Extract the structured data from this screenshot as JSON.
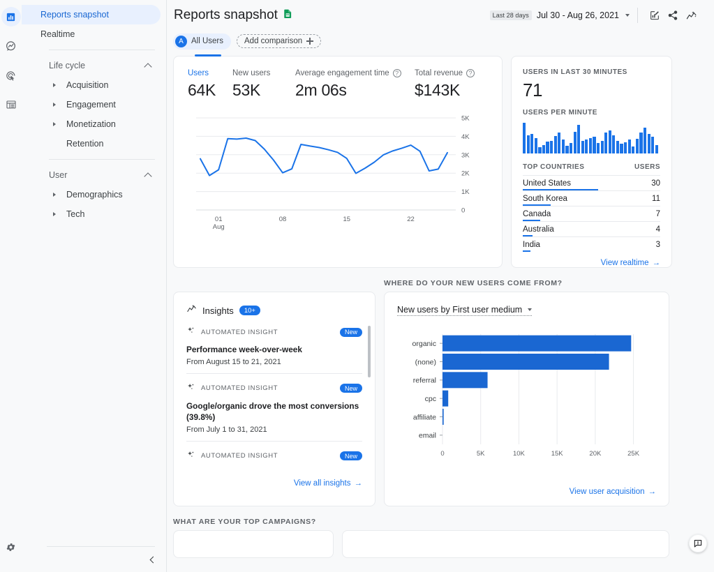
{
  "rail": {
    "items": [
      {
        "name": "reports-icon",
        "label": "Reports",
        "active": true
      },
      {
        "name": "explore-icon",
        "label": "Explore",
        "active": false
      },
      {
        "name": "advertising-icon",
        "label": "Advertising",
        "active": false
      },
      {
        "name": "library-icon",
        "label": "Library",
        "active": false
      }
    ],
    "settings_label": "Admin"
  },
  "sidebar": {
    "top_items": [
      {
        "label": "Reports snapshot",
        "selected": true
      },
      {
        "label": "Realtime",
        "selected": false
      }
    ],
    "sections": [
      {
        "title": "Life cycle",
        "items": [
          {
            "label": "Acquisition",
            "expandable": true
          },
          {
            "label": "Engagement",
            "expandable": true
          },
          {
            "label": "Monetization",
            "expandable": true
          },
          {
            "label": "Retention",
            "expandable": false
          }
        ]
      },
      {
        "title": "User",
        "items": [
          {
            "label": "Demographics",
            "expandable": true
          },
          {
            "label": "Tech",
            "expandable": true
          }
        ]
      }
    ]
  },
  "header": {
    "title": "Reports snapshot",
    "title_icon": "sheets-export-icon",
    "date_chip": "Last 28 days",
    "date_range": "Jul 30 - Aug 26, 2021",
    "actions": [
      {
        "name": "customize-report-icon",
        "label": "Customize report"
      },
      {
        "name": "share-icon",
        "label": "Share this report"
      },
      {
        "name": "insights-icon",
        "label": "Insights"
      }
    ]
  },
  "comparison": {
    "all_users_initial": "A",
    "all_users_label": "All Users",
    "add_comparison_label": "Add comparison"
  },
  "metrics_card": {
    "metrics": [
      {
        "label": "Users",
        "value": "64K",
        "active": true,
        "help": false
      },
      {
        "label": "New users",
        "value": "53K",
        "active": false,
        "help": false
      },
      {
        "label": "Average engagement time",
        "value": "2m 06s",
        "active": false,
        "help": true
      },
      {
        "label": "Total revenue",
        "value": "$143K",
        "active": false,
        "help": true
      }
    ]
  },
  "realtime": {
    "users_label": "USERS IN LAST 30 MINUTES",
    "users_value": "71",
    "per_minute_label": "USERS PER MINUTE",
    "per_minute_values": [
      44,
      26,
      28,
      22,
      9,
      12,
      17,
      18,
      25,
      30,
      20,
      11,
      15,
      31,
      41,
      18,
      20,
      22,
      24,
      15,
      18,
      30,
      33,
      26,
      18,
      14,
      16,
      20,
      10,
      21,
      30,
      37,
      28,
      24,
      12
    ],
    "countries_header": "TOP COUNTRIES",
    "users_header": "USERS",
    "countries": [
      {
        "name": "United States",
        "users": 30
      },
      {
        "name": "South Korea",
        "users": 11
      },
      {
        "name": "Canada",
        "users": 7
      },
      {
        "name": "Australia",
        "users": 4
      },
      {
        "name": "India",
        "users": 3
      }
    ],
    "link_label": "View realtime"
  },
  "insights": {
    "title": "Insights",
    "count_badge": "10+",
    "items": [
      {
        "kind": "AUTOMATED INSIGHT",
        "badge": "New",
        "title": "Performance week-over-week",
        "subtitle": "From August 15 to 21, 2021"
      },
      {
        "kind": "AUTOMATED INSIGHT",
        "badge": "New",
        "title": "Google/organic drove the most conversions (39.8%)",
        "subtitle": "From July 1 to 31, 2021"
      },
      {
        "kind": "AUTOMATED INSIGHT",
        "badge": "New",
        "title": "",
        "subtitle": ""
      }
    ],
    "link_label": "View all insights"
  },
  "acquisition": {
    "section_title": "WHERE DO YOUR NEW USERS COME FROM?",
    "chart_title": "New users by First user medium",
    "link_label": "View user acquisition"
  },
  "campaigns": {
    "section_title": "WHAT ARE YOUR TOP CAMPAIGNS?"
  },
  "feedback": {
    "label": "Send feedback"
  },
  "colors": {
    "accent": "#1a73e8",
    "accent_light": "#e8f0fe",
    "bar": "#1a67d2",
    "text": "#202124",
    "muted": "#5f6368",
    "bg": "#f8f9fa",
    "card": "#ffffff",
    "border": "#e8eaed"
  },
  "chart_data": [
    {
      "type": "line",
      "title": "Users over time",
      "xlabel": "",
      "ylabel": "Users",
      "ylim": [
        0,
        5000
      ],
      "yticks": [
        0,
        1000,
        2000,
        3000,
        4000,
        5000
      ],
      "ytick_labels": [
        "0",
        "1K",
        "2K",
        "3K",
        "4K",
        "5K"
      ],
      "xtick_labels": [
        "01\nAug",
        "08",
        "15",
        "22"
      ],
      "xtick_positions": [
        2,
        9,
        16,
        23
      ],
      "x": [
        0,
        1,
        2,
        3,
        4,
        5,
        6,
        7,
        8,
        9,
        10,
        11,
        12,
        13,
        14,
        15,
        16,
        17,
        18,
        19,
        20,
        21,
        22,
        23,
        24,
        25,
        26,
        27
      ],
      "values": [
        2780,
        1870,
        2180,
        3870,
        3850,
        3900,
        3770,
        3300,
        2710,
        2020,
        2230,
        3560,
        3470,
        3390,
        3270,
        3130,
        2800,
        1990,
        2270,
        2590,
        2990,
        3200,
        3350,
        3520,
        3190,
        2120,
        2220,
        3110
      ],
      "grid": true,
      "series_color": "#1a73e8"
    },
    {
      "type": "bar",
      "orientation": "horizontal",
      "title": "New users by First user medium",
      "categories": [
        "organic",
        "(none)",
        "referral",
        "cpc",
        "affiliate",
        "email"
      ],
      "values": [
        24700,
        21800,
        5900,
        750,
        150,
        0
      ],
      "xlabel": "",
      "ylabel": "",
      "xlim": [
        0,
        26500
      ],
      "xticks": [
        0,
        5000,
        10000,
        15000,
        20000,
        25000
      ],
      "xtick_labels": [
        "0",
        "5K",
        "10K",
        "15K",
        "20K",
        "25K"
      ],
      "grid": true,
      "bar_color": "#1a67d2"
    },
    {
      "type": "bar",
      "title": "Users per minute",
      "categories": [
        "1",
        "2",
        "3",
        "4",
        "5",
        "6",
        "7",
        "8",
        "9",
        "10",
        "11",
        "12",
        "13",
        "14",
        "15",
        "16",
        "17",
        "18",
        "19",
        "20",
        "21",
        "22",
        "23",
        "24",
        "25",
        "26",
        "27",
        "28",
        "29",
        "30",
        "31",
        "32",
        "33",
        "34",
        "35"
      ],
      "values": [
        44,
        26,
        28,
        22,
        9,
        12,
        17,
        18,
        25,
        30,
        20,
        11,
        15,
        31,
        41,
        18,
        20,
        22,
        24,
        15,
        18,
        30,
        33,
        26,
        18,
        14,
        16,
        20,
        10,
        21,
        30,
        37,
        28,
        24,
        12
      ],
      "ylim": [
        0,
        46
      ],
      "grid": false,
      "bar_color": "#1a73e8"
    }
  ]
}
